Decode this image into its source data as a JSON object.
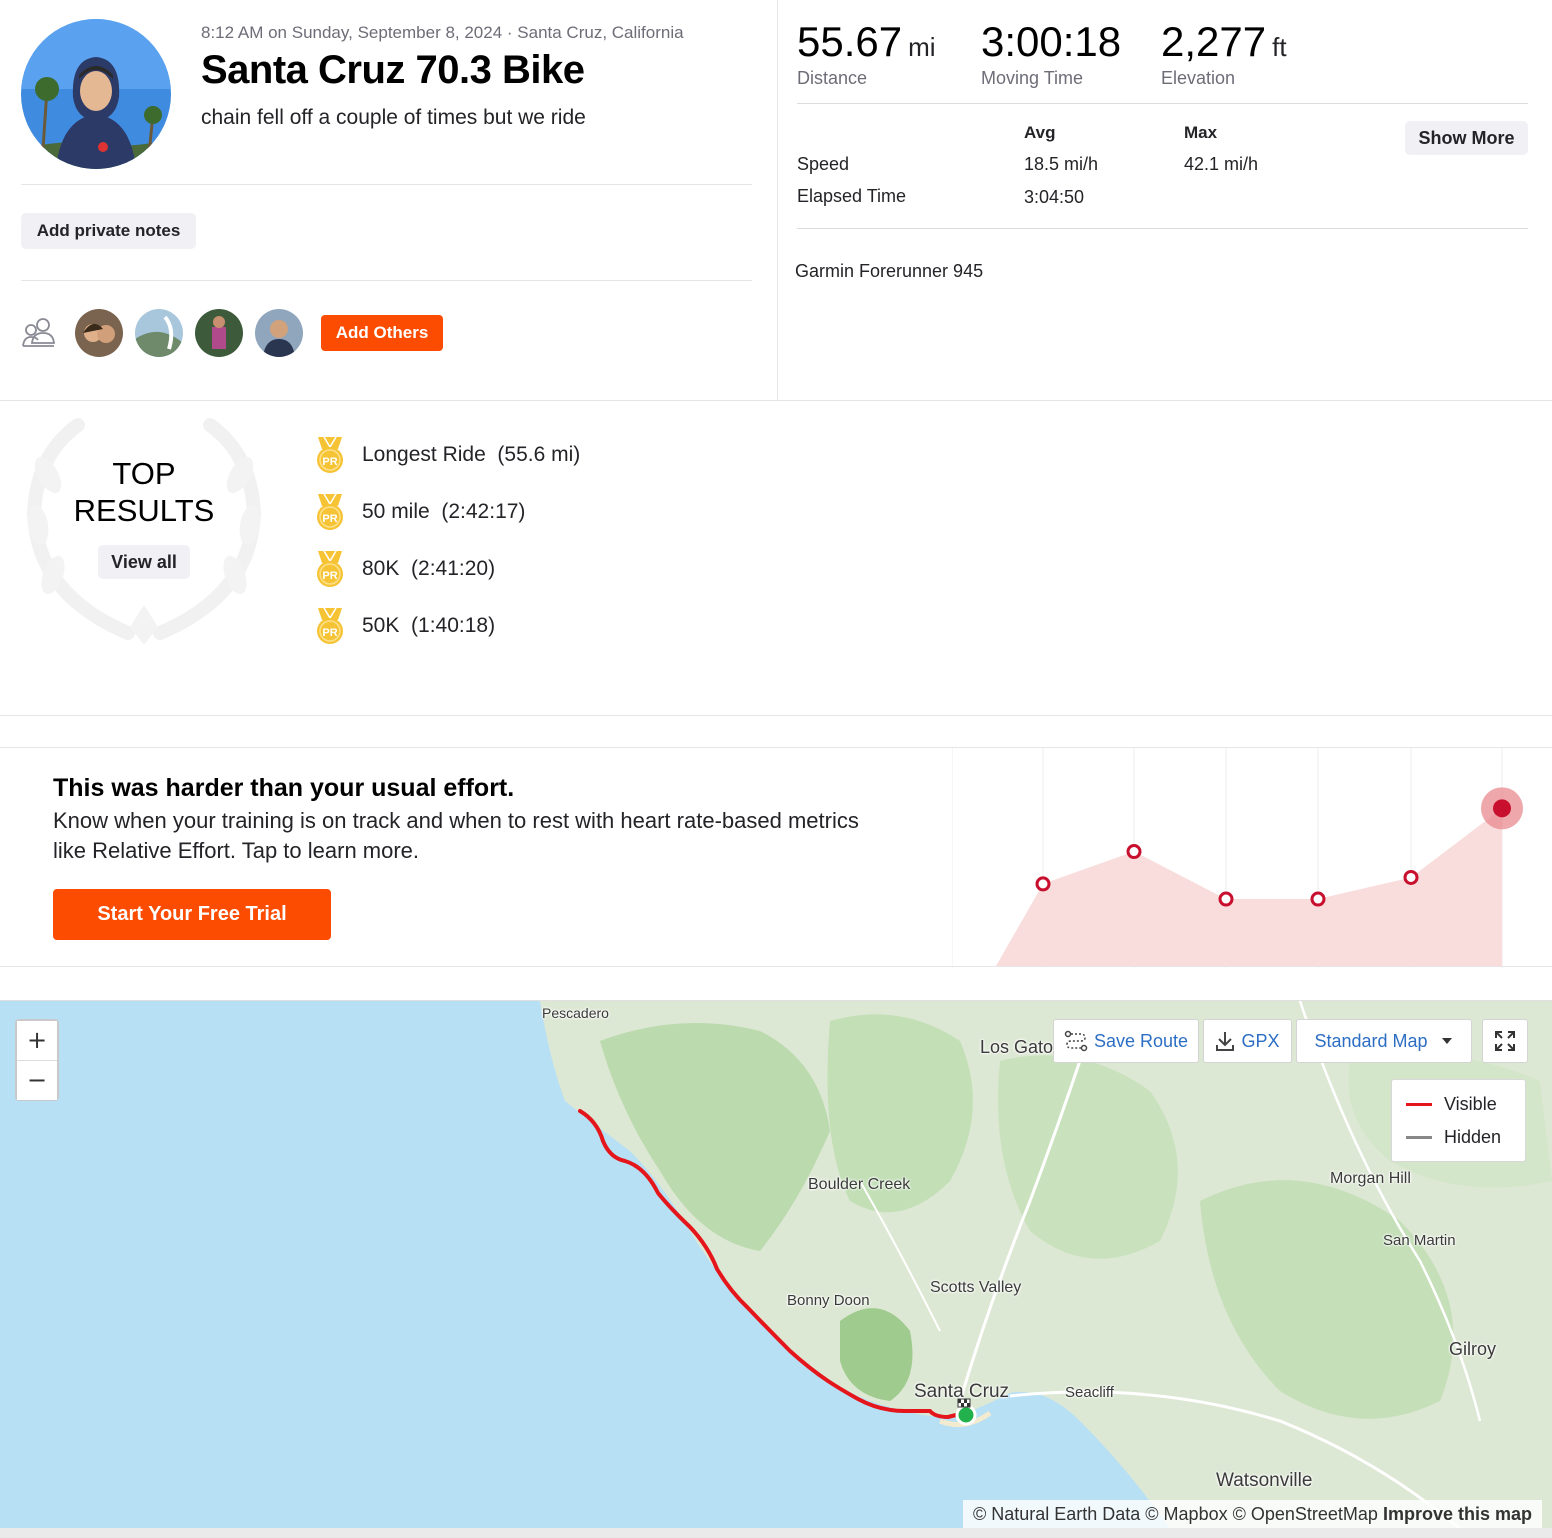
{
  "activity": {
    "datetime_location": "8:12 AM on Sunday, September 8, 2024 · Santa Cruz, California",
    "title": "Santa Cruz 70.3 Bike",
    "description": "chain fell off a couple of times but we ride"
  },
  "actions": {
    "add_private_notes": "Add private notes",
    "add_others": "Add Others",
    "show_more": "Show More",
    "view_all": "View all",
    "start_trial": "Start Your Free Trial"
  },
  "stats": {
    "distance": {
      "value": "55.67",
      "unit": "mi",
      "label": "Distance"
    },
    "moving_time": {
      "value": "3:00:18",
      "label": "Moving Time"
    },
    "elevation": {
      "value": "2,277",
      "unit": "ft",
      "label": "Elevation"
    }
  },
  "detail_table": {
    "col_avg": "Avg",
    "col_max": "Max",
    "rows": [
      {
        "label": "Speed",
        "avg": "18.5 mi/h",
        "max": "42.1 mi/h"
      },
      {
        "label": "Elapsed Time",
        "avg": "3:04:50",
        "max": ""
      }
    ]
  },
  "device": "Garmin Forerunner 945",
  "top_results": {
    "heading_line1": "TOP",
    "heading_line2": "RESULTS",
    "badge_text": "PR",
    "items": [
      "Longest Ride  (55.6 mi)",
      "50 mile  (2:42:17)",
      "80K  (2:41:20)",
      "50K  (1:40:18)"
    ]
  },
  "effort": {
    "title": "This was harder than your usual effort.",
    "body": "Know when your training is on track and when to rest with heart rate-based metrics like Relative Effort. Tap to learn more.",
    "relative_effort_levels": [
      0.38,
      0.53,
      0.31,
      0.31,
      0.41,
      0.73
    ],
    "colors": {
      "fill": "#f9dcdc",
      "marker": "#c8102e"
    }
  },
  "map": {
    "controls": {
      "zoom_in": "+",
      "zoom_out": "−",
      "save_route": "Save Route",
      "gpx": "GPX",
      "map_style": "Standard Map"
    },
    "legend": {
      "visible": "Visible",
      "hidden": "Hidden"
    },
    "places": {
      "pescadero": "Pescadero",
      "los_gatos": "Los Gato",
      "boulder_creek": "Boulder Creek",
      "morgan_hill": "Morgan Hill",
      "san_martin": "San Martin",
      "scotts_valley": "Scotts Valley",
      "bonny_doon": "Bonny Doon",
      "gilroy": "Gilroy",
      "santa_cruz": "Santa Cruz",
      "seacliff": "Seacliff",
      "watsonville": "Watsonville"
    },
    "attribution": "© Natural Earth Data © Mapbox © OpenStreetMap",
    "improve": "Improve this map",
    "colors": {
      "route": "#e4151b",
      "start": "#22b14c",
      "ocean": "#b8e0f5",
      "land": "#dde8d4",
      "forest": "#b5d7a7"
    }
  },
  "brand_color": "#fc4c02"
}
